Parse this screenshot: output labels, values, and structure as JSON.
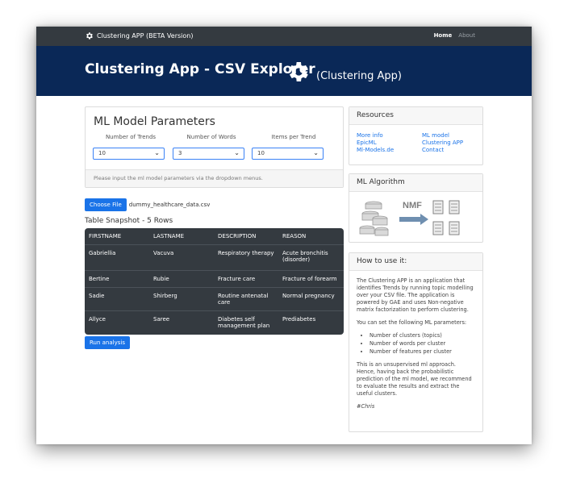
{
  "navbar": {
    "brand": "Clustering APP (BETA Version)",
    "home": "Home",
    "about": "About"
  },
  "hero": {
    "title": "Clustering App - CSV Explorer",
    "subtitle": "(Clustering App)"
  },
  "params": {
    "title": "ML Model Parameters",
    "labels": [
      "Number of Trends",
      "Number of Words",
      "Items per Trend"
    ],
    "values": [
      "10",
      "3",
      "10"
    ],
    "footer": "Please input the ml model parameters via the dropdown menus."
  },
  "file": {
    "button": "Choose File",
    "name": "dummy_healthcare_data.csv"
  },
  "table": {
    "title": "Table Snapshot - 5 Rows",
    "headers": [
      "FIRSTNAME",
      "LASTNAME",
      "DESCRIPTION",
      "REASON"
    ],
    "rows": [
      [
        "Gabriellia",
        "Vacuva",
        "Respiratory therapy",
        "Acute bronchitis (disorder)"
      ],
      [
        "Bertine",
        "Rubie",
        "Fracture care",
        "Fracture of forearm"
      ],
      [
        "Sadie",
        "Shirberg",
        "Routine antenatal care",
        "Normal pregnancy"
      ],
      [
        "Allyce",
        "Saree",
        "Diabetes self management plan",
        "Prediabetes"
      ]
    ]
  },
  "run_button": "Run analysis",
  "resources": {
    "title": "Resources",
    "links": [
      "More info",
      "ML model",
      "EpicML",
      "Clustering APP",
      "Ml-Models.de",
      "Contact"
    ]
  },
  "algorithm": {
    "title": "ML Algorithm",
    "label": "NMF"
  },
  "howto": {
    "title": "How to use it:",
    "p1": "The Clustering APP is an application that identifies Trends by running topic modelling over your CSV file. The application is powered by GAE and uses Non-negative matrix factorization to perform clustering.",
    "p2": "You can set the following ML parameters:",
    "items": [
      "Number of clusters (topics)",
      "Number of words per cluster",
      "Number of features per cluster"
    ],
    "p3": "This is an unsupervised ml approach. Hence, having back the probabilistic prediction of the ml model, we recommend to evaluate the results and extract the useful clusters.",
    "signature": "#Chris"
  },
  "colors": {
    "navbar": "#343a40",
    "hero": "#0a2857",
    "accent": "#1a73e8"
  }
}
